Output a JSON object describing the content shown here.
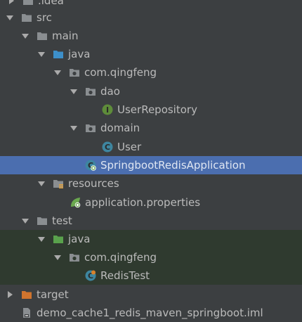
{
  "tree": {
    "idea": ".idea",
    "src": "src",
    "main": "main",
    "java_main": "java",
    "pkg_main": "com.qingfeng",
    "dao": "dao",
    "user_repository": "UserRepository",
    "domain": "domain",
    "user": "User",
    "app": "SpringbootRedisApplication",
    "resources": "resources",
    "app_props": "application.properties",
    "test": "test",
    "java_test": "java",
    "pkg_test": "com.qingfeng",
    "redis_test": "RedisTest",
    "target": "target",
    "iml": "demo_cache1_redis_maven_springboot.iml"
  },
  "colors": {
    "background": "#3c3f41",
    "selection": "#4b6eaf",
    "test_area": "#2f3a2f",
    "folder": "#8a8e91",
    "source_folder": "#3d8fc9",
    "test_folder": "#59a24c",
    "excluded_folder": "#d0742e",
    "interface": "#5e8c3a",
    "class": "#3e86a0"
  }
}
